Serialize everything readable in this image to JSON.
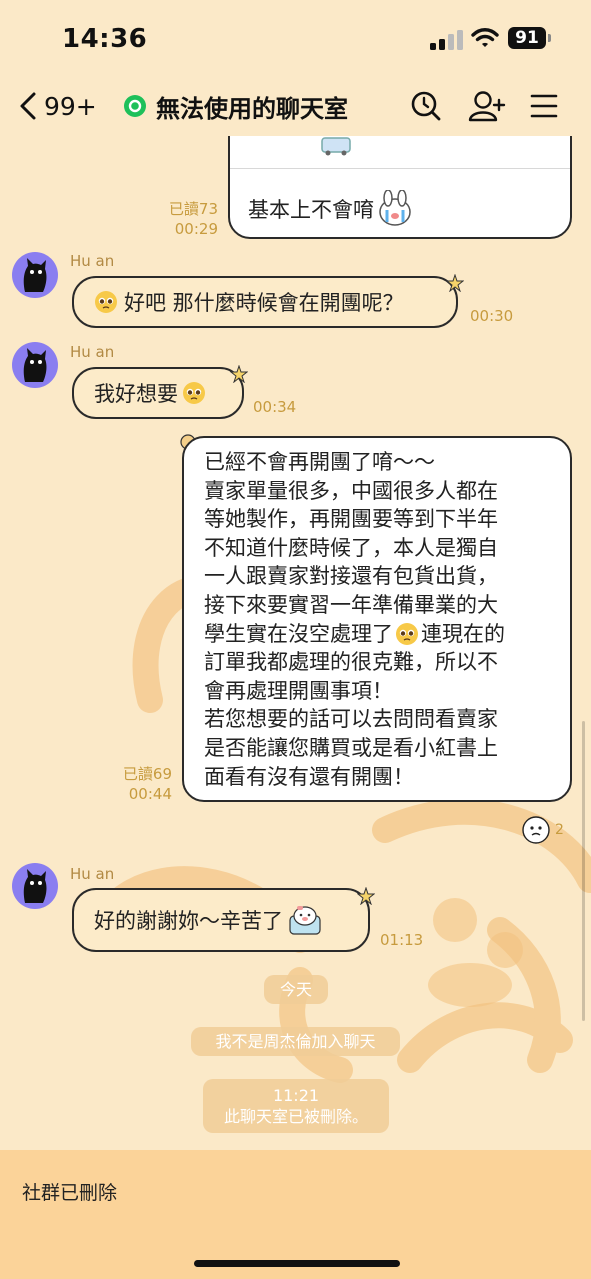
{
  "status_bar": {
    "time": "14:36",
    "battery": "91"
  },
  "nav": {
    "back_count": "99+",
    "title": "無法使用的聊天室",
    "icons": [
      "search-icon",
      "add-friend-icon",
      "menu-icon"
    ]
  },
  "messages": {
    "m1": {
      "text": "基本上不會唷",
      "read": "已讀73",
      "time": "00:29"
    },
    "m2": {
      "sender": "Hu an",
      "text": "好吧 那什麼時候會在開團呢？",
      "time": "00:30"
    },
    "m3": {
      "sender": "Hu an",
      "text": "我好想要",
      "time": "00:34"
    },
    "m4": {
      "lines": [
        "已經不會再開團了唷～～",
        "賣家單量很多，中國很多人都在",
        "等她製作，再開團要等到下半年",
        "不知道什麼時候了，本人是獨自",
        "一人跟賣家對接還有包貨出貨，",
        "接下來要實習一年準備畢業的大",
        "學生實在沒空處理了",
        "連現在的",
        "訂單我都處理的很克難，所以不",
        "會再處理開團事項！",
        "若您想要的話可以去問問看賣家",
        "是否能讓您購買或是看小紅書上",
        "面看有沒有還有開團！"
      ],
      "read": "已讀69",
      "time": "00:44",
      "reaction_count": "2"
    },
    "m5": {
      "sender": "Hu an",
      "text": "好的謝謝妳～辛苦了",
      "time": "01:13"
    }
  },
  "system": {
    "date_label": "今天",
    "joined": "我不是周杰倫加入聊天",
    "deleted_time": "11:21",
    "deleted_text": "此聊天室已被刪除。"
  },
  "bottom": {
    "label": "社群已刪除"
  },
  "colors": {
    "background": "#fbe9c8",
    "incoming_bubble": "#fcebc9",
    "outgoing_bubble": "#ffffff",
    "timestamp": "#c79b3e",
    "bottom_bar": "#fbd399",
    "avatar": "#8a7ef0"
  }
}
